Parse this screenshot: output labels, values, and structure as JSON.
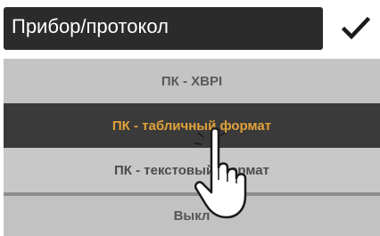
{
  "header": {
    "title": "Прибор/протокол",
    "confirm_icon": "checkmark-icon"
  },
  "dropdown": {
    "options": [
      {
        "label": "ПК - XBPI"
      },
      {
        "label": "ПК - табличный формат",
        "selected": true
      },
      {
        "label": "ПК - текстовый формат"
      },
      {
        "label": "Выкл"
      }
    ]
  },
  "cursor": {
    "icon": "pointing-hand-icon"
  },
  "colors": {
    "title_background": "#2b2b2b",
    "selected_background": "#3a3a3a",
    "selected_text": "#e0a23a",
    "option_background": "#c4c4c4"
  }
}
